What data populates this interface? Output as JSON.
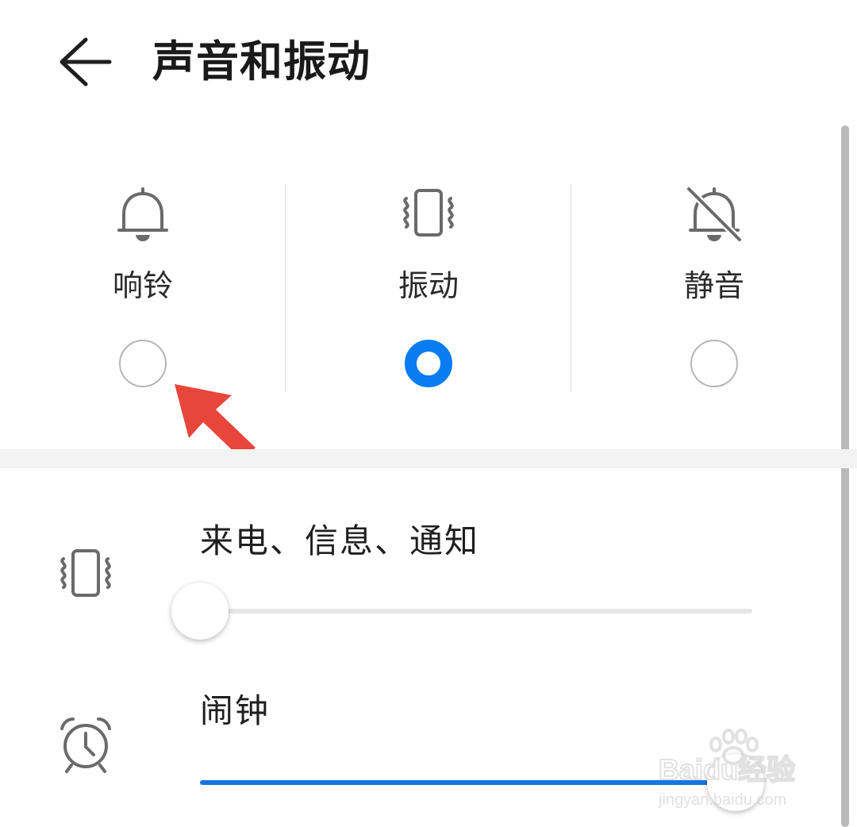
{
  "header": {
    "title": "声音和振动"
  },
  "modes": [
    {
      "label": "响铃",
      "icon": "bell-icon",
      "selected": false
    },
    {
      "label": "振动",
      "icon": "vibrate-phone-icon",
      "selected": true
    },
    {
      "label": "静音",
      "icon": "bell-off-icon",
      "selected": false
    }
  ],
  "sliders": [
    {
      "title": "来电、信息、通知",
      "icon": "vibrate-phone-icon",
      "level": 0.0
    },
    {
      "title": "闹钟",
      "icon": "alarm-clock-icon",
      "level": 0.97
    }
  ],
  "colors": {
    "accent": "#0a7cf2",
    "annotation": "#e8463a"
  },
  "watermark": {
    "text": "Baidu经验",
    "url_text": "jingyan.baidu.com"
  }
}
